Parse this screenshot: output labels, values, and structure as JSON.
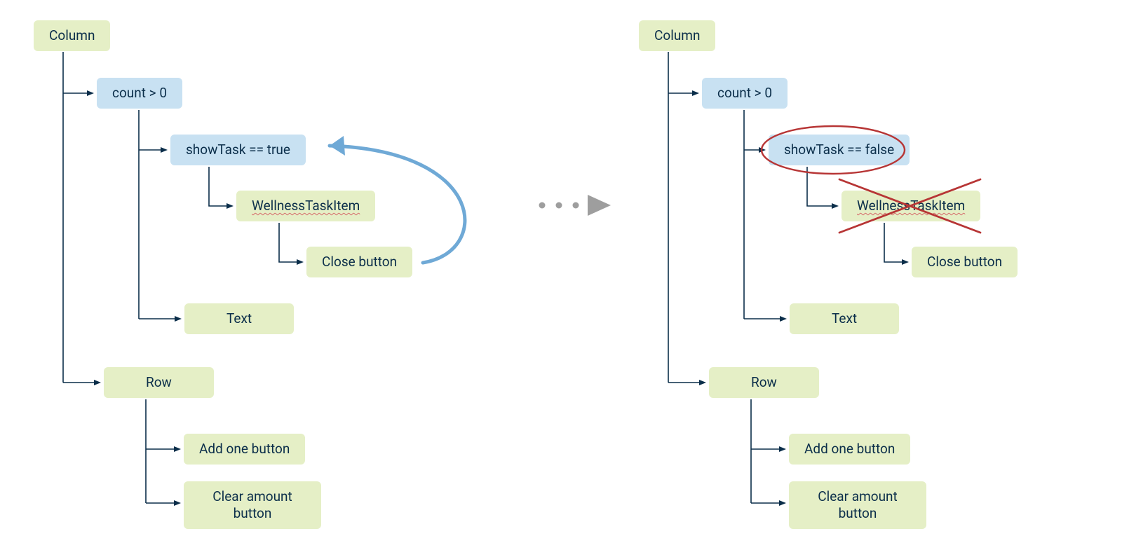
{
  "colors": {
    "greenNode": "#e5efc6",
    "blueNode": "#c8e1f2",
    "textColor": "#0b2e4a",
    "callbackArrow": "#6fa9d6",
    "transitionArrow": "#9e9e9e",
    "highlightRed": "#b73535",
    "background": "#ffffff"
  },
  "transition": {
    "style": "dotted-arrow"
  },
  "left": {
    "column": "Column",
    "count": "count > 0",
    "showTask": "showTask == true",
    "wellnessTask": "WellnessTaskItem",
    "closeButton": "Close button",
    "text": "Text",
    "row": "Row",
    "addOne": "Add one button",
    "clearAmount": "Clear amount button",
    "callbackNote": "Close button triggers showTask"
  },
  "right": {
    "column": "Column",
    "count": "count > 0",
    "showTask": "showTask == false",
    "wellnessTask": "WellnessTaskItem",
    "closeButton": "Close button",
    "text": "Text",
    "row": "Row",
    "addOne": "Add one button",
    "clearAmount": "Clear amount button",
    "showTaskHighlighted": true,
    "wellnessTaskRemoved": true
  }
}
